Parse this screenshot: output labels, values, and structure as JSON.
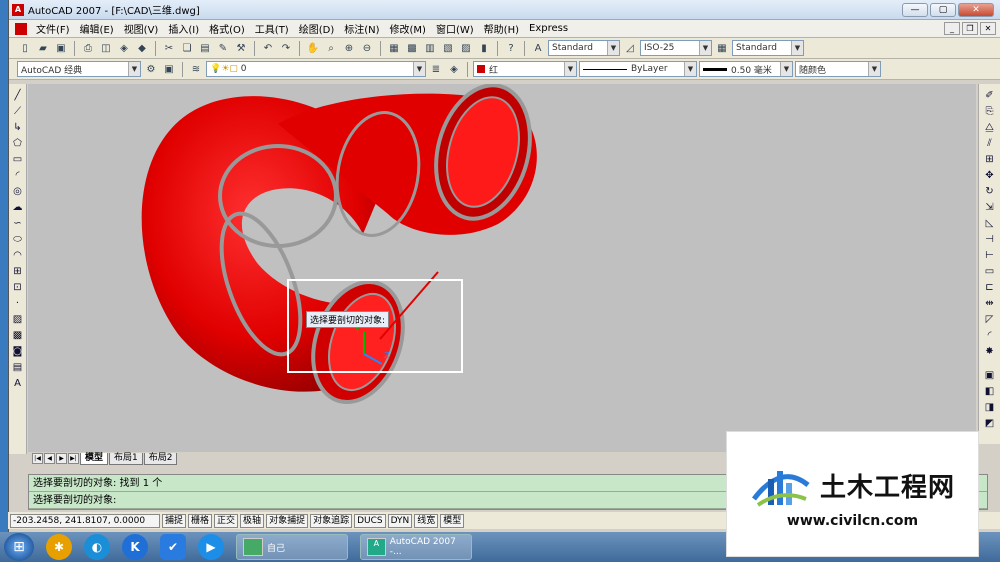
{
  "window": {
    "title": "AutoCAD 2007 - [F:\\CAD\\三维.dwg]",
    "minimize": "—",
    "restore": "▢",
    "close": "✕"
  },
  "menus": [
    "文件(F)",
    "编辑(E)",
    "视图(V)",
    "插入(I)",
    "格式(O)",
    "工具(T)",
    "绘图(D)",
    "标注(N)",
    "修改(M)",
    "窗口(W)",
    "帮助(H)",
    "Express"
  ],
  "toolbar2": {
    "text_style": "Standard",
    "dim_style": "ISO-25",
    "table_style": "Standard"
  },
  "toolbar3": {
    "workspace": "AutoCAD 经典",
    "layer": "0",
    "color": "红",
    "linetype": "ByLayer",
    "lineweight": "0.50 毫米",
    "plotstyle": "随颜色"
  },
  "canvas": {
    "tooltip": "选择要剖切的对象:",
    "axis_z": "Z",
    "axis_y": "Y"
  },
  "tabs": [
    "模型",
    "布局1",
    "布局2"
  ],
  "command": {
    "line1": "选择要剖切的对象: 找到 1 个",
    "line2": "选择要剖切的对象:"
  },
  "status": {
    "coords": "-203.2458, 241.8107, 0.0000",
    "buttons": [
      "捕捉",
      "栅格",
      "正交",
      "极轴",
      "对象捕捉",
      "对象追踪",
      "DUCS",
      "DYN",
      "线宽",
      "模型"
    ]
  },
  "taskbar": {
    "task1": "自己",
    "task2": "AutoCAD 2007 -..."
  },
  "watermark": {
    "brand": "土木工程网",
    "url": "www.civilcn.com"
  },
  "colors": {
    "accent": "#cc0000",
    "canvas": "#c0c0c0",
    "command_bg": "#c8e6c8"
  }
}
